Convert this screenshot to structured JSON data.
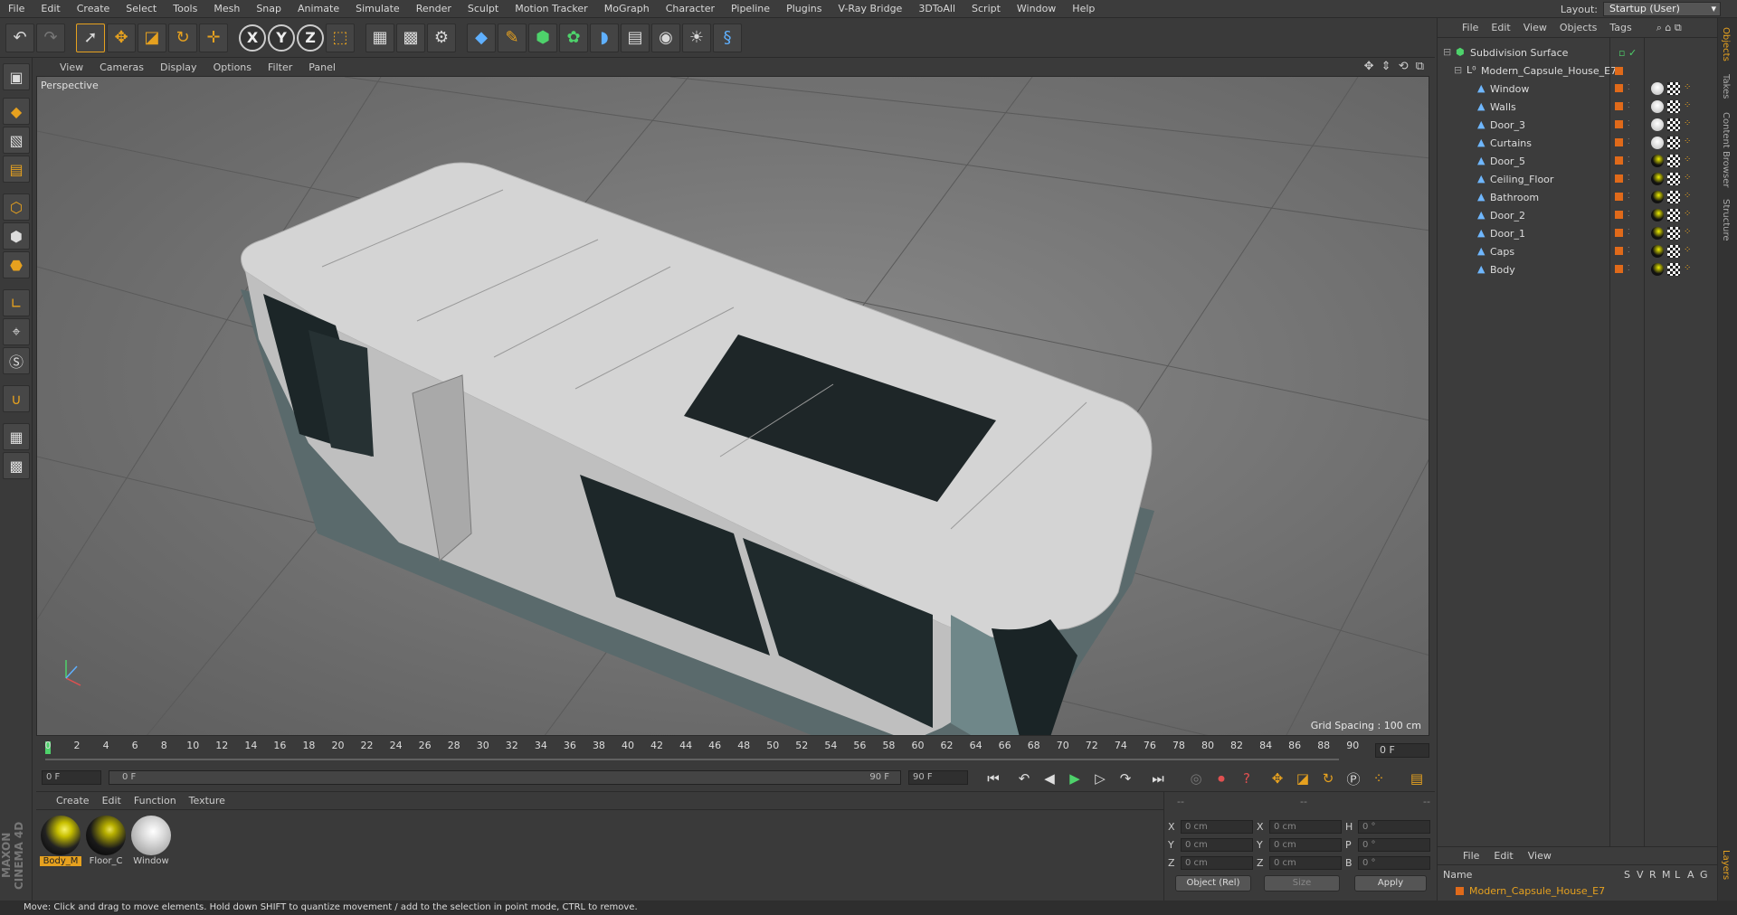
{
  "menubar": {
    "items": [
      "File",
      "Edit",
      "Create",
      "Select",
      "Tools",
      "Mesh",
      "Snap",
      "Animate",
      "Simulate",
      "Render",
      "Sculpt",
      "Motion Tracker",
      "MoGraph",
      "Character",
      "Pipeline",
      "Plugins",
      "V-Ray Bridge",
      "3DToAll",
      "Script",
      "Window",
      "Help"
    ],
    "layout_label": "Layout:",
    "layout_value": "Startup (User)"
  },
  "viewport": {
    "menu": [
      "View",
      "Cameras",
      "Display",
      "Options",
      "Filter",
      "Panel"
    ],
    "label": "Perspective",
    "grid_spacing": "Grid Spacing : 100 cm"
  },
  "timeline": {
    "ticks": [
      "0",
      "2",
      "4",
      "6",
      "8",
      "10",
      "12",
      "14",
      "16",
      "18",
      "20",
      "22",
      "24",
      "26",
      "28",
      "30",
      "32",
      "34",
      "36",
      "38",
      "40",
      "42",
      "44",
      "46",
      "48",
      "50",
      "52",
      "54",
      "56",
      "58",
      "60",
      "62",
      "64",
      "66",
      "68",
      "70",
      "72",
      "74",
      "76",
      "78",
      "80",
      "82",
      "84",
      "86",
      "88",
      "90"
    ],
    "current_frame": "0 F"
  },
  "transport": {
    "start_field": "0 F",
    "range_start": "0 F",
    "range_end": "90 F",
    "end_field": "90 F"
  },
  "materials": {
    "menu": [
      "Create",
      "Edit",
      "Function",
      "Texture"
    ],
    "items": [
      {
        "label": "Body_M",
        "color": "#c8c000"
      },
      {
        "label": "Floor_C",
        "color": "#b8b000"
      },
      {
        "label": "Window",
        "color": "#d9d9d9"
      }
    ]
  },
  "coords": {
    "header": [
      "--",
      "--",
      "--"
    ],
    "rows": [
      {
        "a": "X",
        "av": "0 cm",
        "b": "X",
        "bv": "0 cm",
        "c": "H",
        "cv": "0 °"
      },
      {
        "a": "Y",
        "av": "0 cm",
        "b": "Y",
        "bv": "0 cm",
        "c": "P",
        "cv": "0 °"
      },
      {
        "a": "Z",
        "av": "0 cm",
        "b": "Z",
        "bv": "0 cm",
        "c": "B",
        "cv": "0 °"
      }
    ],
    "mode": "Object (Rel)",
    "size": "Size",
    "apply": "Apply"
  },
  "objects": {
    "menu": [
      "File",
      "Edit",
      "View",
      "Objects",
      "Tags"
    ],
    "root": "Subdivision Surface",
    "group": "Modern_Capsule_House_E7",
    "children": [
      "Window",
      "Walls",
      "Door_3",
      "Curtains",
      "Door_5",
      "Ceiling_Floor",
      "Bathroom",
      "Door_2",
      "Door_1",
      "Caps",
      "Body"
    ]
  },
  "layers": {
    "menu": [
      "File",
      "Edit",
      "View"
    ],
    "columns": [
      "Name",
      "S",
      "V",
      "R",
      "M",
      "L",
      "A",
      "G"
    ],
    "row": "Modern_Capsule_House_E7"
  },
  "right_tabs": [
    "Objects",
    "Takes",
    "Content Browser",
    "Structure",
    "Layers"
  ],
  "brand": "MAXON CINEMA 4D",
  "status": "Move: Click and drag to move elements. Hold down SHIFT to quantize movement / add to the selection in point mode, CTRL to remove."
}
